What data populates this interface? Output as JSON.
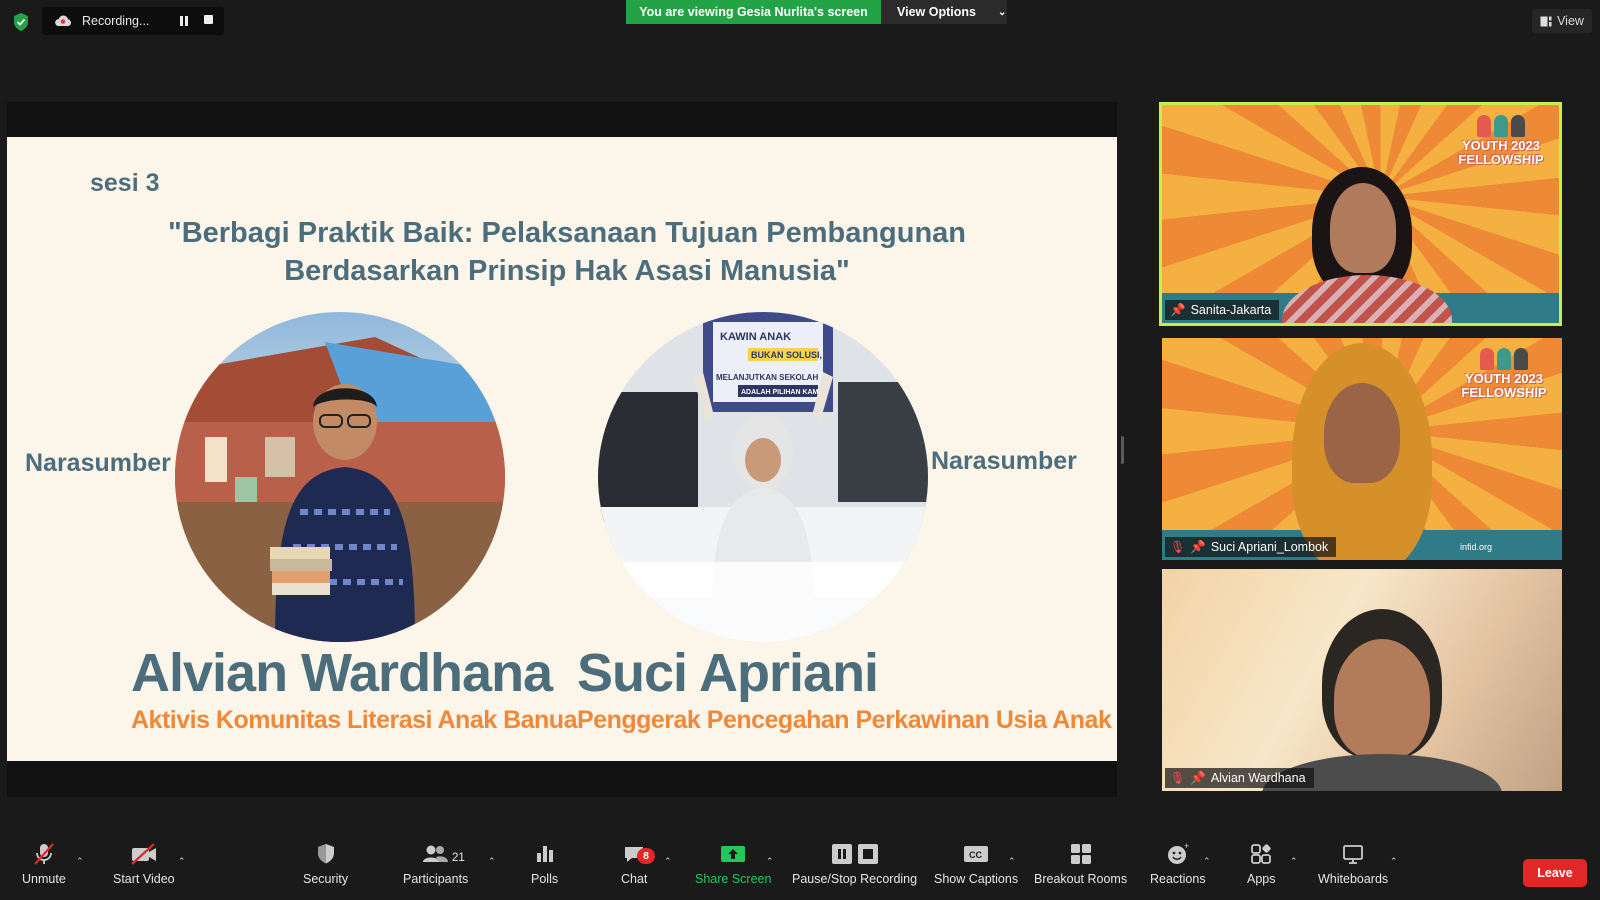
{
  "top_bar": {
    "recording_label": "Recording...",
    "banner_text": "You are viewing Gesia Nurlita's screen",
    "view_options_label": "View Options",
    "view_label": "View"
  },
  "slide": {
    "session": "sesi 3",
    "title_line1": "\"Berbagi Praktik Baik: Pelaksanaan Tujuan Pembangunan",
    "title_line2": "Berdasarkan Prinsip Hak Asasi Manusia\"",
    "speaker_label_left": "Narasumber",
    "speaker_label_right": "Narasumber",
    "speaker1_name": "Alvian Wardhana",
    "speaker1_role": "Aktivis Komunitas Literasi Anak Banua",
    "speaker2_name": "Suci Apriani",
    "speaker2_role": "Penggerak Pencegahan Perkawinan Usia Anak",
    "placard_line1": "KAWIN ANAK",
    "placard_line2": "BUKAN SOLUSI,",
    "placard_line3": "MELANJUTKAN SEKOLAH",
    "placard_line4": "ADALAH PILIHAN KAMI"
  },
  "participants": [
    {
      "name": "Sanita-Jakarta",
      "muted": false,
      "active_speaker": true
    },
    {
      "name": "Suci Apriani_Lombok",
      "muted": true,
      "active_speaker": false
    },
    {
      "name": "Alvian Wardhana",
      "muted": true,
      "active_speaker": false
    }
  ],
  "tile_branding": {
    "logo_line1": "YOUTH 2023",
    "logo_line2": "FELLOWSHIP",
    "watermark": "infid.org"
  },
  "toolbar": {
    "unmute": "Unmute",
    "start_video": "Start Video",
    "security": "Security",
    "participants": "Participants",
    "participant_count": "21",
    "polls": "Polls",
    "chat": "Chat",
    "chat_badge": "8",
    "share_screen": "Share Screen",
    "pause_stop_recording": "Pause/Stop Recording",
    "show_captions": "Show Captions",
    "breakout_rooms": "Breakout Rooms",
    "reactions": "Reactions",
    "apps": "Apps",
    "whiteboards": "Whiteboards",
    "leave": "Leave"
  },
  "colors": {
    "banner_green": "#23a246",
    "active_speaker_border": "#c4f04e",
    "leave_red": "#e02828",
    "slide_text": "#4b6d7c",
    "slide_accent": "#f0883a"
  }
}
